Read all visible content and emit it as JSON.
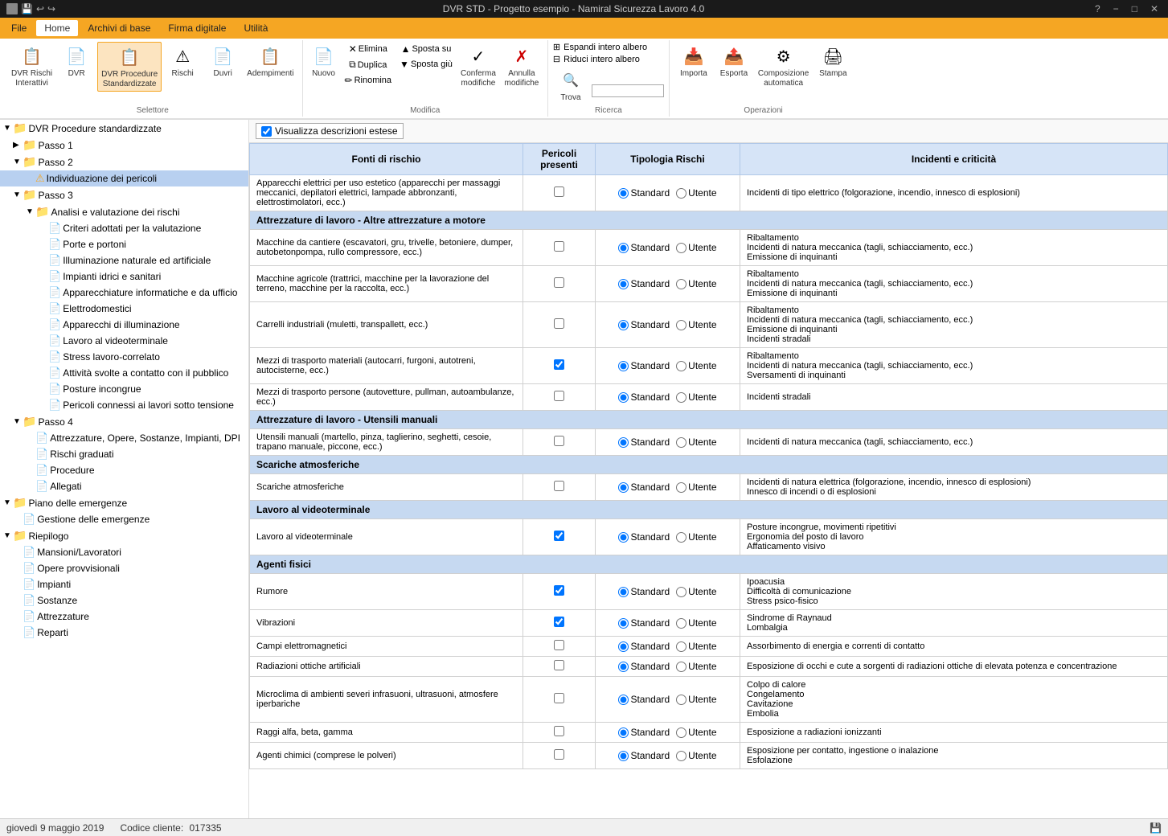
{
  "title_bar": {
    "title": "DVR STD - Progetto esempio - Namiral Sicurezza Lavoro 4.0",
    "help_icon": "?",
    "minimize": "−",
    "maximize": "□",
    "close": "✕"
  },
  "menu": {
    "items": [
      "File",
      "Home",
      "Archivi di base",
      "Firma digitale",
      "Utilità"
    ],
    "active": "Home"
  },
  "ribbon": {
    "groups": [
      {
        "label": "Selettore",
        "buttons": [
          {
            "label": "DVR Rischi\nInterattivi",
            "icon": "📋"
          },
          {
            "label": "DVR",
            "icon": "📄"
          },
          {
            "label": "DVR Procedure\nStandardizzate",
            "icon": "📋",
            "active": true
          },
          {
            "label": "Rischi",
            "icon": "⚠"
          },
          {
            "label": "Duvri",
            "icon": "📄"
          },
          {
            "label": "Adempimenti",
            "icon": "📋"
          }
        ]
      },
      {
        "label": "Modifica",
        "buttons_col1": [
          {
            "label": "Elimina",
            "icon": "✕"
          },
          {
            "label": "Duplica",
            "icon": "⧉"
          },
          {
            "label": "Rinomina",
            "icon": "✏"
          }
        ],
        "buttons_col2": [
          {
            "label": "Sposta su",
            "icon": "▲"
          },
          {
            "label": "Sposta giù",
            "icon": "▼"
          }
        ],
        "buttons_main": [
          {
            "label": "Nuovo",
            "icon": "📄"
          },
          {
            "label": "Conferma\nmodifiche",
            "icon": "✓"
          },
          {
            "label": "Annulla\nmodifiche",
            "icon": "✗"
          }
        ]
      },
      {
        "label": "Ricerca",
        "buttons": [
          {
            "label": "Espandi intero albero",
            "icon": ""
          },
          {
            "label": "Riduci intero albero",
            "icon": ""
          },
          {
            "label": "Trova",
            "icon": "🔍"
          }
        ]
      },
      {
        "label": "Operazioni",
        "buttons": [
          {
            "label": "Importa",
            "icon": "📥"
          },
          {
            "label": "Esporta",
            "icon": "📤"
          },
          {
            "label": "Composizione\nautomatica",
            "icon": "⚙"
          },
          {
            "label": "Stampa",
            "icon": "🖨"
          }
        ]
      }
    ]
  },
  "sidebar": {
    "items": [
      {
        "id": "dvr-root",
        "label": "DVR Procedure standardizzate",
        "indent": 1,
        "type": "root",
        "expanded": true
      },
      {
        "id": "passo1",
        "label": "Passo 1",
        "indent": 2,
        "type": "folder",
        "expanded": false
      },
      {
        "id": "passo2",
        "label": "Passo 2",
        "indent": 2,
        "type": "folder",
        "expanded": true
      },
      {
        "id": "individuazione",
        "label": "Individuazione dei pericoli",
        "indent": 3,
        "type": "warning",
        "selected": true
      },
      {
        "id": "passo3",
        "label": "Passo 3",
        "indent": 2,
        "type": "folder",
        "expanded": true
      },
      {
        "id": "analisi",
        "label": "Analisi e valutazione dei rischi",
        "indent": 3,
        "type": "folder",
        "expanded": true
      },
      {
        "id": "criteri",
        "label": "Criteri adottati per la valutazione",
        "indent": 4,
        "type": "doc"
      },
      {
        "id": "porte",
        "label": "Porte e portoni",
        "indent": 4,
        "type": "doc"
      },
      {
        "id": "illuminazione",
        "label": "Illuminazione naturale ed artificiale",
        "indent": 4,
        "type": "doc"
      },
      {
        "id": "impianti-idrici",
        "label": "Impianti idrici e sanitari",
        "indent": 4,
        "type": "doc"
      },
      {
        "id": "apparecchiature",
        "label": "Apparecchiature informatiche e da ufficio",
        "indent": 4,
        "type": "doc"
      },
      {
        "id": "elettrodomestici",
        "label": "Elettrodomestici",
        "indent": 4,
        "type": "doc"
      },
      {
        "id": "apparecchi-illuminazione",
        "label": "Apparecchi di illuminazione",
        "indent": 4,
        "type": "doc"
      },
      {
        "id": "lavoro-videoterminale",
        "label": "Lavoro al videoterminale",
        "indent": 4,
        "type": "doc"
      },
      {
        "id": "stress",
        "label": "Stress lavoro-correlato",
        "indent": 4,
        "type": "doc"
      },
      {
        "id": "attivita-pubblico",
        "label": "Attività svolte a contatto con il pubblico",
        "indent": 4,
        "type": "doc"
      },
      {
        "id": "posture",
        "label": "Posture incongrue",
        "indent": 4,
        "type": "doc"
      },
      {
        "id": "pericoli-tensione",
        "label": "Pericoli connessi ai lavori sotto tensione",
        "indent": 4,
        "type": "doc"
      },
      {
        "id": "passo4",
        "label": "Passo 4",
        "indent": 2,
        "type": "folder",
        "expanded": true
      },
      {
        "id": "attrezzature-opere",
        "label": "Attrezzature, Opere, Sostanze, Impianti, DPI",
        "indent": 3,
        "type": "doc"
      },
      {
        "id": "rischi-graduati",
        "label": "Rischi graduati",
        "indent": 3,
        "type": "doc"
      },
      {
        "id": "procedure",
        "label": "Procedure",
        "indent": 3,
        "type": "doc"
      },
      {
        "id": "allegati",
        "label": "Allegati",
        "indent": 3,
        "type": "doc"
      },
      {
        "id": "piano-emergenze",
        "label": "Piano delle emergenze",
        "indent": 1,
        "type": "root",
        "expanded": true
      },
      {
        "id": "gestione-emergenze",
        "label": "Gestione delle emergenze",
        "indent": 2,
        "type": "doc"
      },
      {
        "id": "riepilogo",
        "label": "Riepilogo",
        "indent": 1,
        "type": "root",
        "expanded": true
      },
      {
        "id": "mansioni",
        "label": "Mansioni/Lavoratori",
        "indent": 2,
        "type": "doc"
      },
      {
        "id": "opere-provvisionali",
        "label": "Opere provvisionali",
        "indent": 2,
        "type": "doc"
      },
      {
        "id": "impianti",
        "label": "Impianti",
        "indent": 2,
        "type": "doc"
      },
      {
        "id": "sostanze",
        "label": "Sostanze",
        "indent": 2,
        "type": "doc"
      },
      {
        "id": "attrezzature",
        "label": "Attrezzature",
        "indent": 2,
        "type": "doc"
      },
      {
        "id": "reparti",
        "label": "Reparti",
        "indent": 2,
        "type": "doc"
      }
    ]
  },
  "content": {
    "checkbox_label": "Visualizza descrizioni estese",
    "checkbox_checked": true,
    "columns": {
      "fonte": "Fonti di rischio",
      "pericoli": "Pericoli presenti",
      "tipologia": "Tipologia Rischi",
      "incidenti": "Incidenti e criticità"
    },
    "rows": [
      {
        "type": "data",
        "fonte": "Apparecchi elettrici per uso estetico (apparecchi per massaggi meccanici, depilatori elettrici, lampade abbronzanti, elettrostimolatori, ecc.)",
        "checked": false,
        "tipologia": "Standard",
        "utente": "Utente",
        "incidenti": "Incidenti di tipo elettrico (folgorazione, incendio, innesco di esplosioni)"
      },
      {
        "type": "subheader",
        "label": "Attrezzature di lavoro - Altre attrezzature a motore"
      },
      {
        "type": "data",
        "fonte": "Macchine da cantiere (escavatori, gru, trivelle, betoniere, dumper, autobetonpompa, rullo compressore, ecc.)",
        "checked": false,
        "tipologia": "Standard",
        "utente": "Utente",
        "incidenti": "Ribaltamento\nIncidenti di natura meccanica (tagli, schiacciamento, ecc.)\nEmissione di inquinanti"
      },
      {
        "type": "data",
        "fonte": "Macchine agricole (trattrici, macchine per la lavorazione del terreno, macchine per la raccolta, ecc.)",
        "checked": false,
        "tipologia": "Standard",
        "utente": "Utente",
        "incidenti": "Ribaltamento\nIncidenti di natura meccanica (tagli, schiacciamento, ecc.)\nEmissione di inquinanti"
      },
      {
        "type": "data",
        "fonte": "Carrelli industriali (muletti, transpallett, ecc.)",
        "checked": false,
        "tipologia": "Standard",
        "utente": "Utente",
        "incidenti": "Ribaltamento\nIncidenti di natura meccanica (tagli, schiacciamento, ecc.)\nEmissione di inquinanti\nIncidenti stradali"
      },
      {
        "type": "data",
        "fonte": "Mezzi di trasporto materiali (autocarri, furgoni, autotreni, autocisterne, ecc.)",
        "checked": true,
        "tipologia": "Standard",
        "utente": "Utente",
        "incidenti": "Ribaltamento\nIncidenti di natura meccanica (tagli, schiacciamento, ecc.)\nSversamenti di inquinanti"
      },
      {
        "type": "data",
        "fonte": "Mezzi di trasporto persone (autovetture, pullman, autoambulanze, ecc.)",
        "checked": false,
        "tipologia": "Standard",
        "utente": "Utente",
        "incidenti": "Incidenti stradali"
      },
      {
        "type": "subheader",
        "label": "Attrezzature di lavoro - Utensili manuali"
      },
      {
        "type": "data",
        "fonte": "Utensili manuali (martello, pinza, taglierino, seghetti, cesoie, trapano manuale, piccone, ecc.)",
        "checked": false,
        "tipologia": "Standard",
        "utente": "Utente",
        "incidenti": "Incidenti di natura meccanica (tagli, schiacciamento, ecc.)"
      },
      {
        "type": "subheader",
        "label": "Scariche atmosferiche"
      },
      {
        "type": "data",
        "fonte": "Scariche atmosferiche",
        "checked": false,
        "tipologia": "Standard",
        "utente": "Utente",
        "incidenti": "Incidenti di natura elettrica (folgorazione, incendio, innesco di esplosioni)\nInnesco di incendi o di esplosioni"
      },
      {
        "type": "subheader",
        "label": "Lavoro al videoterminale"
      },
      {
        "type": "data",
        "fonte": "Lavoro al videoterminale",
        "checked": true,
        "tipologia": "Standard",
        "utente": "Utente",
        "incidenti": "Posture incongrue, movimenti ripetitivi\nErgonomia del posto di lavoro\nAffaticamento visivo"
      },
      {
        "type": "subheader",
        "label": "Agenti fisici"
      },
      {
        "type": "data",
        "fonte": "Rumore",
        "checked": true,
        "tipologia": "Standard",
        "utente": "Utente",
        "incidenti": "Ipoacusia\nDifficoltà di comunicazione\nStress psico-fisico"
      },
      {
        "type": "data",
        "fonte": "Vibrazioni",
        "checked": true,
        "tipologia": "Standard",
        "utente": "Utente",
        "incidenti": "Sindrome di Raynaud\nLombalgia"
      },
      {
        "type": "data",
        "fonte": "Campi elettromagnetici",
        "checked": false,
        "tipologia": "Standard",
        "utente": "Utente",
        "incidenti": "Assorbimento di energia e correnti di contatto"
      },
      {
        "type": "data",
        "fonte": "Radiazioni ottiche artificiali",
        "checked": false,
        "tipologia": "Standard",
        "utente": "Utente",
        "incidenti": "Esposizione di occhi e cute a sorgenti di radiazioni ottiche di elevata potenza e concentrazione"
      },
      {
        "type": "data",
        "fonte": "Microclima di ambienti severi infrasuoni, ultrasuoni, atmosfere iperbariche",
        "checked": false,
        "tipologia": "Standard",
        "utente": "Utente",
        "incidenti": "Colpo di calore\nCongelamento\nCavitazione\nEmbolia"
      },
      {
        "type": "data",
        "fonte": "Raggi alfa, beta, gamma",
        "checked": false,
        "tipologia": "Standard",
        "utente": "Utente",
        "incidenti": "Esposizione a radiazioni ionizzanti"
      },
      {
        "type": "data",
        "fonte": "Agenti chimici (comprese le polveri)",
        "checked": false,
        "tipologia": "Standard",
        "utente": "Utente",
        "incidenti": "Esposizione per contatto, ingestione o inalazione\nEsfolazione"
      }
    ]
  },
  "status_bar": {
    "date": "giovedì 9 maggio 2019",
    "codice_label": "Codice cliente:",
    "codice": "017335"
  }
}
